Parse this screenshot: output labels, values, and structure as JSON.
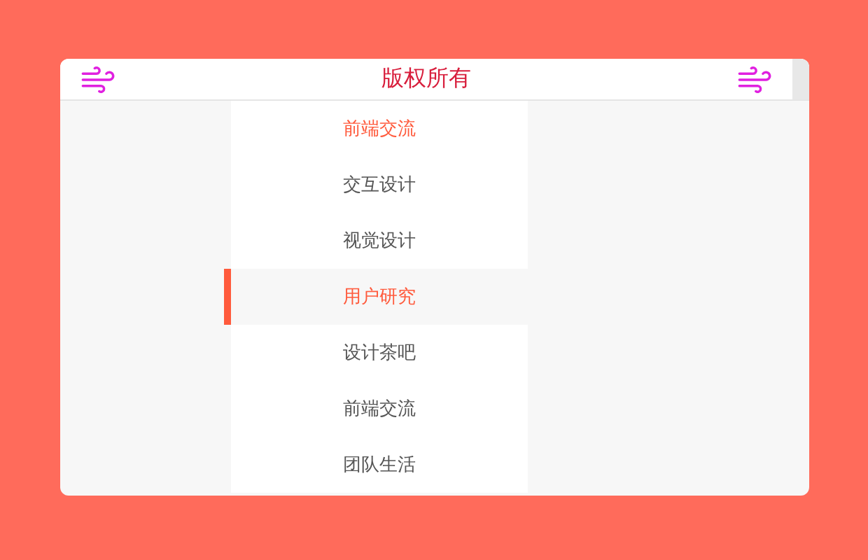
{
  "header": {
    "title": "版权所有"
  },
  "menu": [
    {
      "label": "前端交流",
      "selected": false,
      "accent": true
    },
    {
      "label": "交互设计",
      "selected": false,
      "accent": false
    },
    {
      "label": "视觉设计",
      "selected": false,
      "accent": false
    },
    {
      "label": "用户研究",
      "selected": true,
      "accent": true
    },
    {
      "label": "设计茶吧",
      "selected": false,
      "accent": false
    },
    {
      "label": "前端交流",
      "selected": false,
      "accent": false
    },
    {
      "label": "团队生活",
      "selected": false,
      "accent": false
    }
  ]
}
